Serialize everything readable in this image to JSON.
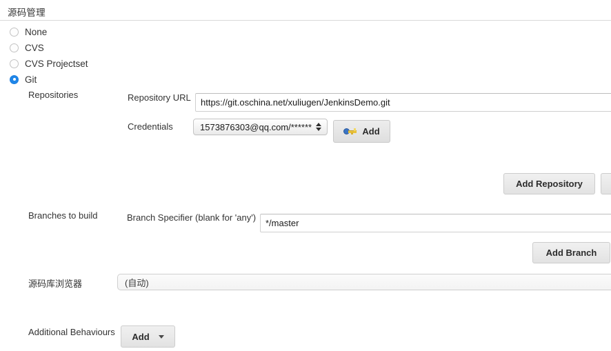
{
  "section": {
    "title": "源码管理"
  },
  "scm_options": [
    {
      "label": "None",
      "selected": false
    },
    {
      "label": "CVS",
      "selected": false
    },
    {
      "label": "CVS Projectset",
      "selected": false
    },
    {
      "label": "Git",
      "selected": true
    }
  ],
  "repositories": {
    "label": "Repositories",
    "repository_url": {
      "label": "Repository URL",
      "value": "https://git.oschina.net/xuliugen/JenkinsDemo.git",
      "placeholder": ""
    },
    "credentials": {
      "label": "Credentials",
      "value": "1573876303@qq.com/******"
    },
    "add_credentials_button": "Add",
    "add_repository_button": "Add Repository"
  },
  "branches": {
    "label": "Branches to build",
    "specifier_label": "Branch Specifier (blank for 'any')",
    "specifier_value": "*/master",
    "add_branch_button": "Add Branch"
  },
  "repository_browser": {
    "label": "源码库浏览器",
    "value": "(自动)"
  },
  "additional_behaviours": {
    "label": "Additional Behaviours",
    "add_button": "Add"
  },
  "colors": {
    "accent": "#1f86e8",
    "rule": "#d9d9d9",
    "button_face": "#e9e9e9",
    "key_bow": "#3b74c4",
    "key_shaft": "#e9c23a"
  }
}
